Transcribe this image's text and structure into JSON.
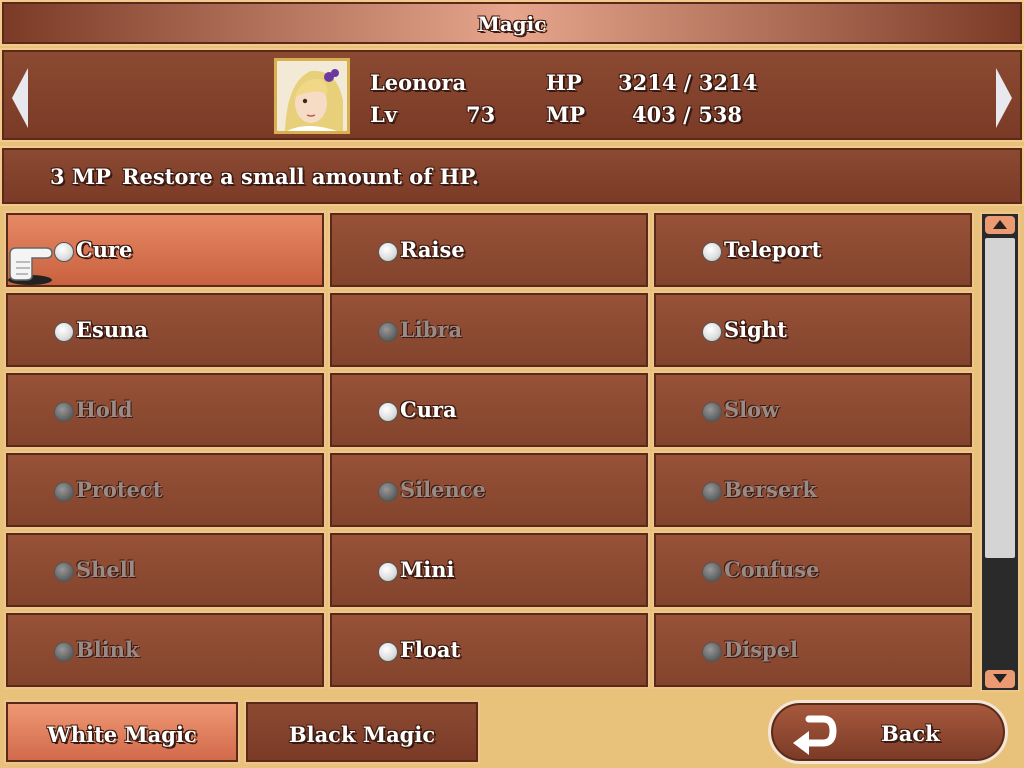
{
  "title": "Magic",
  "character": {
    "name": "Leonora",
    "lv_label": "Lv",
    "lv": "73",
    "hp_label": "HP",
    "hp": "3214 / 3214",
    "mp_label": "MP",
    "mp": "403 / 538"
  },
  "description": {
    "cost": "3 MP",
    "text": "Restore a small amount of HP."
  },
  "spells": [
    {
      "name": "Cure",
      "enabled": true,
      "selected": true
    },
    {
      "name": "Raise",
      "enabled": true
    },
    {
      "name": "Teleport",
      "enabled": true
    },
    {
      "name": "Esuna",
      "enabled": true
    },
    {
      "name": "Libra",
      "enabled": false
    },
    {
      "name": "Sight",
      "enabled": true
    },
    {
      "name": "Hold",
      "enabled": false
    },
    {
      "name": "Cura",
      "enabled": true
    },
    {
      "name": "Slow",
      "enabled": false
    },
    {
      "name": "Protect",
      "enabled": false
    },
    {
      "name": "Silence",
      "enabled": false
    },
    {
      "name": "Berserk",
      "enabled": false
    },
    {
      "name": "Shell",
      "enabled": false
    },
    {
      "name": "Mini",
      "enabled": true
    },
    {
      "name": "Confuse",
      "enabled": false
    },
    {
      "name": "Blink",
      "enabled": false
    },
    {
      "name": "Float",
      "enabled": true
    },
    {
      "name": "Dispel",
      "enabled": false
    }
  ],
  "tabs": [
    {
      "label": "White Magic",
      "active": true
    },
    {
      "label": "Black Magic",
      "active": false
    }
  ],
  "back_label": "Back",
  "icons": {
    "left": "arrow-left-icon",
    "right": "arrow-right-icon",
    "cursor": "pointing-hand-icon",
    "back": "return-arrow-icon"
  },
  "colors": {
    "panel": "#7a3a26",
    "selected": "#d0684a",
    "border": "#f0c48a"
  }
}
